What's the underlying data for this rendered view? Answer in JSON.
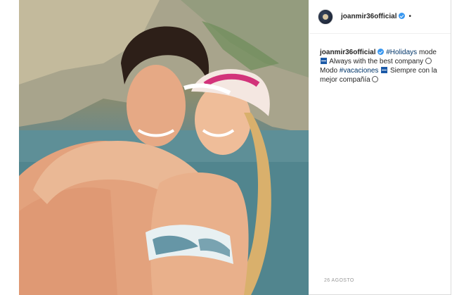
{
  "post": {
    "username": "joanmir36official",
    "more_dot": "•",
    "caption_parts": {
      "username": "joanmir36official",
      "tag_holidays": "#Holidays",
      "text1": " mode ",
      "text2": " Always with the best company ",
      "text3": " Modo ",
      "tag_vacaciones": "#vacaciones",
      "text4": " Siempre con la mejor compañía "
    },
    "date": "26 AGOSTO"
  },
  "icons": {
    "verified": "verified-badge-icon",
    "flag": "flag-emoji-icon",
    "smile": "smile-emoji-icon"
  },
  "colors": {
    "hashtag": "#003569",
    "verified": "#3897f0",
    "border": "#dbdbdb"
  }
}
